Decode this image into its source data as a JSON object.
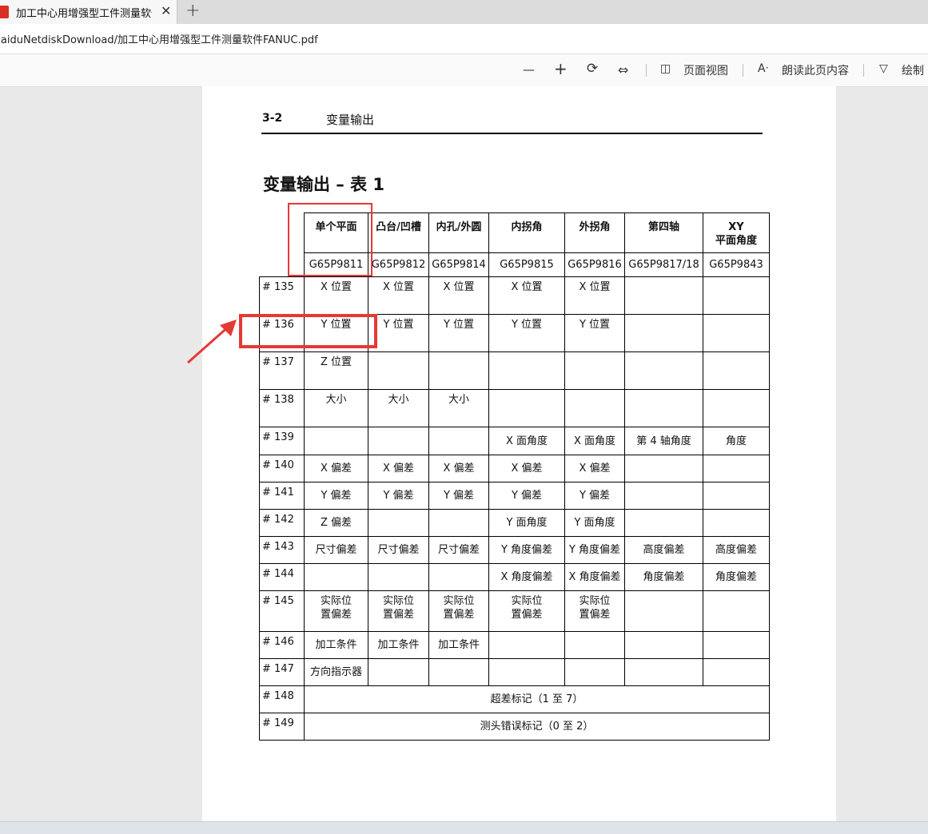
{
  "browser": {
    "tab_title": "加工中心用增强型工件测量软件F",
    "close_glyph": "✕",
    "new_tab_glyph": "+",
    "url": "BaiduNetdiskDownload/加工中心用增强型工件测量软件FANUC.pdf"
  },
  "toolbar": {
    "zoom_out": "—",
    "zoom_in": "+",
    "rotate": "⟳",
    "fit": "⇔",
    "page_view_icon": "◫",
    "page_view": "页面视图",
    "read_aloud_icon": "Aᐧ",
    "read_aloud": "朗读此页内容",
    "draw_icon": "▽",
    "draw": "绘制"
  },
  "document": {
    "header_number": "3-2",
    "header_title": "变量输出",
    "title": "变量输出 – 表 1",
    "columns": [
      {
        "name": "单个平面",
        "code": "G65P9811"
      },
      {
        "name": "凸台/凹槽",
        "code": "G65P9812"
      },
      {
        "name": "内孔/外圆",
        "code": "G65P9814"
      },
      {
        "name": "内拐角",
        "code": "G65P9815"
      },
      {
        "name": "外拐角",
        "code": "G65P9816"
      },
      {
        "name": "第四轴",
        "code": "G65P9817/18"
      },
      {
        "name": "XY\n平面角度",
        "code": "G65P9843"
      }
    ],
    "rows": [
      {
        "label": "# 135",
        "cells": [
          "X 位置",
          "X 位置",
          "X 位置",
          "X 位置",
          "X 位置",
          "",
          ""
        ]
      },
      {
        "label": "# 136",
        "cells": [
          "Y 位置",
          "Y 位置",
          "Y 位置",
          "Y 位置",
          "Y 位置",
          "",
          ""
        ]
      },
      {
        "label": "# 137",
        "cells": [
          "Z 位置",
          "",
          "",
          "",
          "",
          "",
          ""
        ]
      },
      {
        "label": "# 138",
        "cells": [
          "大小",
          "大小",
          "大小",
          "",
          "",
          "",
          ""
        ]
      },
      {
        "label": "# 139",
        "cells": [
          "",
          "",
          "",
          "X 面角度",
          "X 面角度",
          "第 4 轴角度",
          "角度"
        ]
      },
      {
        "label": "# 140",
        "cells": [
          "X 偏差",
          "X 偏差",
          "X 偏差",
          "X 偏差",
          "X 偏差",
          "",
          ""
        ]
      },
      {
        "label": "# 141",
        "cells": [
          "Y 偏差",
          "Y 偏差",
          "Y 偏差",
          "Y 偏差",
          "Y 偏差",
          "",
          ""
        ]
      },
      {
        "label": "# 142",
        "cells": [
          "Z 偏差",
          "",
          "",
          "Y 面角度",
          "Y 面角度",
          "",
          ""
        ]
      },
      {
        "label": "# 143",
        "cells": [
          "尺寸偏差",
          "尺寸偏差",
          "尺寸偏差",
          "Y 角度偏差",
          "Y 角度偏差",
          "高度偏差",
          "高度偏差"
        ]
      },
      {
        "label": "# 144",
        "cells": [
          "",
          "",
          "",
          "X 角度偏差",
          "X 角度偏差",
          "角度偏差",
          "角度偏差"
        ]
      },
      {
        "label": "# 145",
        "cells": [
          "实际位\n置偏差",
          "实际位\n置偏差",
          "实际位\n置偏差",
          "实际位\n置偏差",
          "实际位\n置偏差",
          "",
          ""
        ]
      },
      {
        "label": "# 146",
        "cells": [
          "加工条件",
          "加工条件",
          "加工条件",
          "",
          "",
          "",
          ""
        ]
      },
      {
        "label": "# 147",
        "cells": [
          "方向指示器",
          "",
          "",
          "",
          "",
          "",
          ""
        ]
      }
    ],
    "span_rows": [
      {
        "label": "# 148",
        "text": "超差标记（1 至 7）"
      },
      {
        "label": "# 149",
        "text": "测头错误标记（0 至 2）"
      }
    ]
  },
  "colors": {
    "annotation_red": "#e53935"
  }
}
